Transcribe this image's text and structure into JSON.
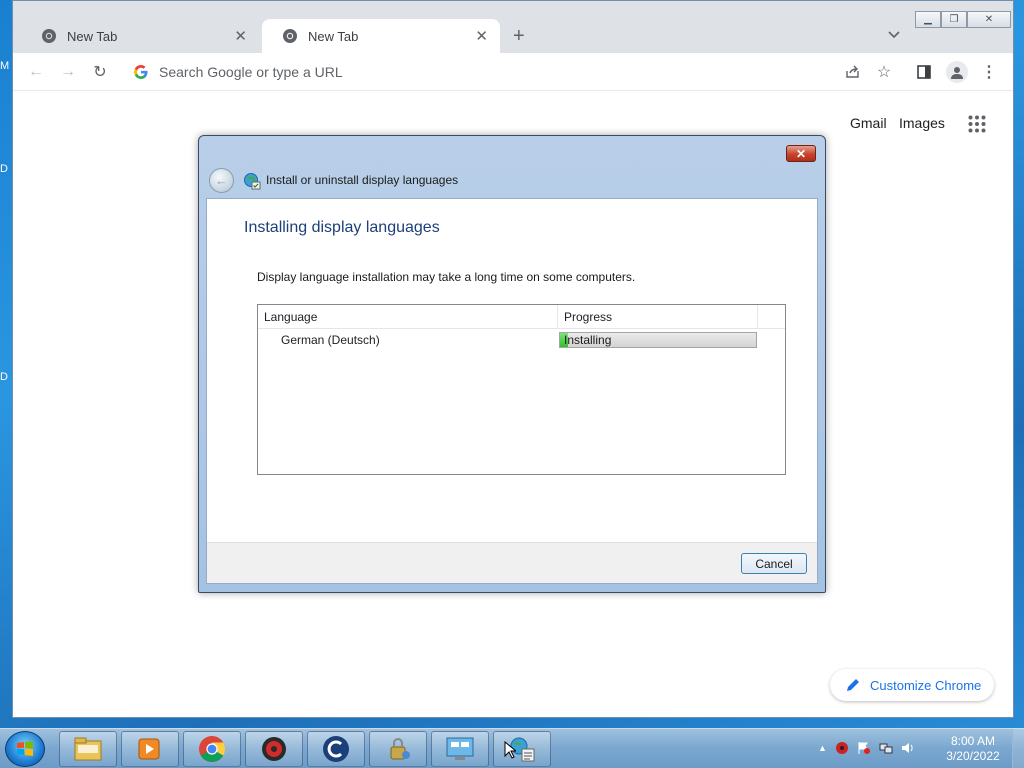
{
  "browser": {
    "tabs": [
      {
        "title": "New Tab",
        "active": false
      },
      {
        "title": "New Tab",
        "active": true
      }
    ],
    "new_tab_symbol": "+",
    "omnibox_placeholder": "Search Google or type a URL",
    "ntp_links": {
      "gmail": "Gmail",
      "images": "Images"
    },
    "customize_label": "Customize Chrome"
  },
  "dialog": {
    "window_title": "Install or uninstall display languages",
    "close_symbol": "✕",
    "heading": "Installing display languages",
    "description": "Display language installation may take a long time on some computers.",
    "columns": {
      "language": "Language",
      "progress": "Progress"
    },
    "rows": [
      {
        "language": "German (Deutsch)",
        "status": "Installing",
        "progress_fraction": 0.04
      }
    ],
    "cancel_label": "Cancel"
  },
  "taskbar": {
    "apps": [
      "file-explorer",
      "media-player",
      "chrome",
      "security-app",
      "ccleaner",
      "user-accounts",
      "control-panel",
      "network-tasks"
    ],
    "clock_time": "8:00 AM",
    "clock_date": "3/20/2022"
  },
  "colors": {
    "dialog_heading": "#1d3f7a",
    "progress_fill": "#2fbf2a",
    "link_blue": "#1a73e8"
  }
}
